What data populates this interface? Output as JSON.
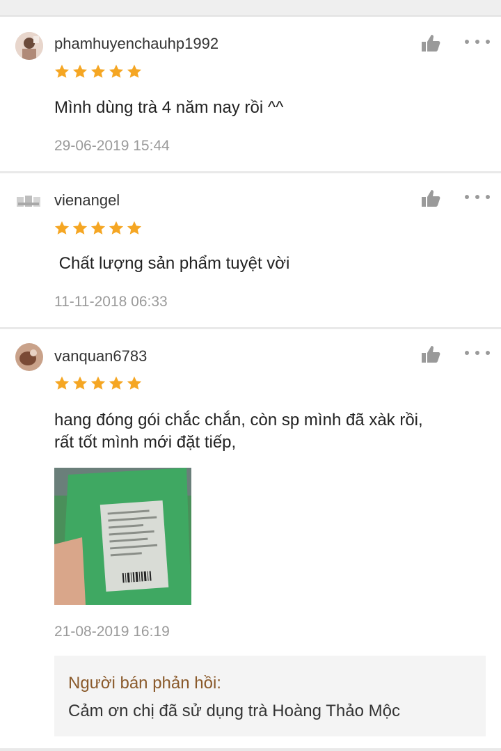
{
  "reviews": [
    {
      "username": "phamhuyenchauhp1992",
      "rating": 5,
      "comment": "Mình dùng trà 4 năm nay rồi ^^",
      "date": "29-06-2019 15:44"
    },
    {
      "username": "vienangel",
      "rating": 5,
      "comment": " Chất lượng sản phẩm tuyệt vời",
      "date": "11-11-2018 06:33"
    },
    {
      "username": "vanquan6783",
      "rating": 5,
      "comment_line1": "hang đóng gói chắc chắn, còn sp mình đã xàk rồi,",
      "comment_line2": "rất tốt mình mới đặt tiếp,",
      "date": "21-08-2019 16:19",
      "seller_reply": {
        "label": "Người bán phản hồi:",
        "text": "Cảm ơn chị đã sử dụng trà Hoàng Thảo Mộc"
      }
    }
  ],
  "colors": {
    "star": "#f5a623",
    "reply_label": "#8a5a2b",
    "date": "#9a9a9a"
  },
  "icons": {
    "like": "thumbs-up-icon",
    "more": "more-dots-icon",
    "star": "star-icon"
  }
}
